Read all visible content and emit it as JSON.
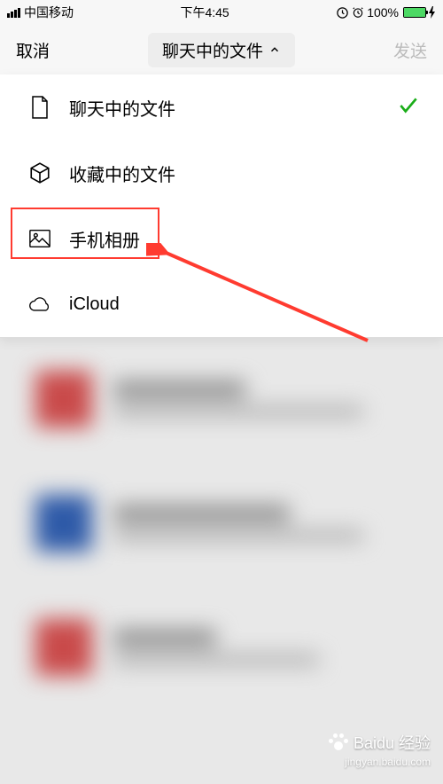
{
  "status_bar": {
    "carrier": "中国移动",
    "time": "下午4:45",
    "battery_pct": "100%"
  },
  "nav": {
    "cancel": "取消",
    "title": "聊天中的文件",
    "send": "发送"
  },
  "menu": {
    "items": [
      {
        "label": "聊天中的文件",
        "selected": true
      },
      {
        "label": "收藏中的文件",
        "selected": false
      },
      {
        "label": "手机相册",
        "selected": false
      },
      {
        "label": "iCloud",
        "selected": false
      }
    ]
  },
  "watermark": {
    "brand": "Baidu 经验",
    "url": "jingyan.baidu.com"
  }
}
